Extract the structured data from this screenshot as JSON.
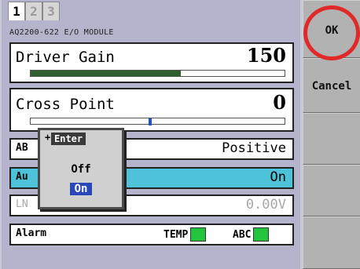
{
  "tabs": [
    "1",
    "2",
    "3"
  ],
  "module_title": "AQ2200-622 E/O MODULE",
  "driver_gain": {
    "label": "Driver Gain",
    "value": "150",
    "fill_fraction": 0.59
  },
  "cross_point": {
    "label": "Cross Point",
    "value": "0",
    "marker_fraction": 0.47
  },
  "rows": [
    {
      "label": "AB",
      "value": "Positive"
    },
    {
      "label": "Au",
      "value": "On"
    },
    {
      "label": "LN",
      "value": "0.00V"
    }
  ],
  "alarm": {
    "label": "Alarm",
    "items": [
      {
        "label": "TEMP",
        "color": "#22c53c"
      },
      {
        "label": "ABC",
        "color": "#22c53c"
      }
    ]
  },
  "popup": {
    "plus": "+",
    "title": "Enter",
    "options": [
      "Off",
      "On"
    ],
    "selected": "On"
  },
  "softkeys": [
    {
      "label": "OK"
    },
    {
      "label": "Cancel"
    },
    {
      "label": ""
    },
    {
      "label": ""
    },
    {
      "label": ""
    }
  ],
  "colors": {
    "highlight_row": "#4ec2d8",
    "selected_option": "#2847b8",
    "ok_circle": "#e02929"
  }
}
